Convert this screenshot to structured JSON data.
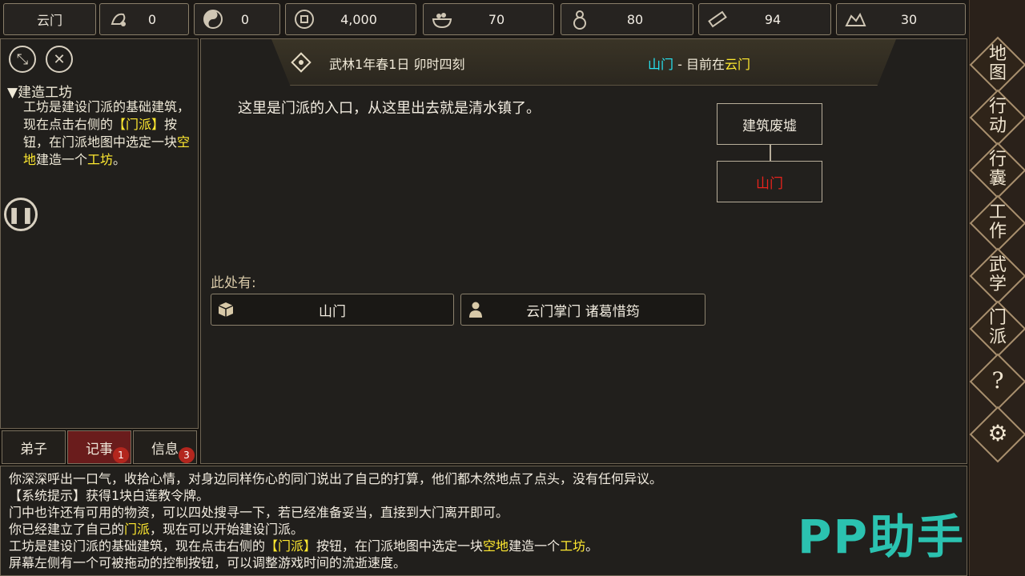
{
  "topbar": {
    "sect_name": "云门",
    "resources": [
      {
        "icon": "reputation-icon",
        "value": "0"
      },
      {
        "icon": "yin-yang-icon",
        "value": "0"
      },
      {
        "icon": "coin-icon",
        "value": "4,000"
      },
      {
        "icon": "food-bowl-icon",
        "value": "70"
      },
      {
        "icon": "gourd-icon",
        "value": "80"
      },
      {
        "icon": "wood-log-icon",
        "value": "94"
      },
      {
        "icon": "ore-icon",
        "value": "30"
      }
    ]
  },
  "quest": {
    "title": "▼建造工坊",
    "body_parts": [
      "工坊是建设门派的基础建筑，现在点击右侧的",
      "【门派】",
      "按钮，在门派地图中选定一块",
      "空地",
      "建造一个",
      "工坊",
      "。"
    ]
  },
  "tabs": [
    {
      "label": "弟子",
      "badge": ""
    },
    {
      "label": "记事",
      "badge": "1"
    },
    {
      "label": "信息",
      "badge": "3"
    }
  ],
  "banner": {
    "date": "武林1年春1日 卯时四刻",
    "location": "山门",
    "separator": "-",
    "current_prefix": "目前在",
    "current_place": "云门"
  },
  "description": "这里是门派的入口，从这里出去就是清水镇了。",
  "map_nodes": {
    "upper": "建筑废墟",
    "current": "山门"
  },
  "here": {
    "label": "此处有:",
    "entities": [
      {
        "icon": "box-icon",
        "name": "山门"
      },
      {
        "icon": "person-icon",
        "name": "云门掌门 诸葛惜筠"
      }
    ]
  },
  "log": {
    "line1": "你深深呼出一口气，收拾心情，对身边同样伤心的同门说出了自己的打算，他们都木然地点了点头，没有任何异议。",
    "line2": "【系统提示】获得1块白莲教令牌。",
    "line3": "门中也许还有可用的物资，可以四处搜寻一下，若已经准备妥当，直接到大门离开即可。",
    "line4_a": "你已经建立了自己的",
    "line4_b": "门派",
    "line4_c": "，现在可以开始建设门派。",
    "line5_a": "工坊是建设门派的基础建筑，现在点击右侧的",
    "line5_b": "【门派】",
    "line5_c": "按钮，在门派地图中选定一块",
    "line5_d": "空地",
    "line5_e": "建造一个",
    "line5_f": "工坊",
    "line5_g": "。",
    "line6": "屏幕左侧有一个可被拖动的控制按钮，可以调整游戏时间的流逝速度。"
  },
  "side_menu": [
    {
      "label_top": "地",
      "label_bottom": "图"
    },
    {
      "label_top": "行",
      "label_bottom": "动"
    },
    {
      "label_top": "行",
      "label_bottom": "囊"
    },
    {
      "label_top": "工",
      "label_bottom": "作"
    },
    {
      "label_top": "武",
      "label_bottom": "学"
    },
    {
      "label_top": "门",
      "label_bottom": "派"
    },
    {
      "label_top": "?",
      "label_bottom": ""
    },
    {
      "label_top": "⚙",
      "label_bottom": ""
    }
  ],
  "watermark": "PP助手",
  "colors": {
    "highlight_yellow": "#ffe930",
    "highlight_cyan": "#27e3f0",
    "current_node_red": "#e8231d",
    "active_tab": "#6a1c1c"
  }
}
